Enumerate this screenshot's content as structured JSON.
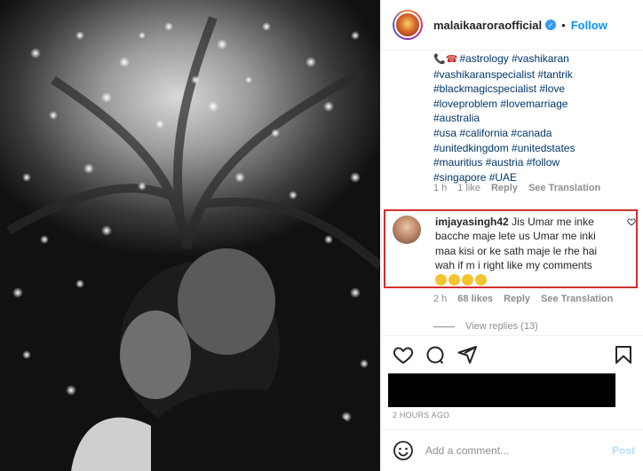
{
  "post": {
    "image": {
      "icon": "selfie-photo"
    }
  },
  "header": {
    "username": "malaikaaroraofficial",
    "verified_icon": "verified-badge-icon",
    "separator": "•",
    "follow_label": "Follow"
  },
  "caption": {
    "lines": [
      "#astrology #vashikaran",
      "#vashikaranspecialist #tantrik",
      "#blackmagicspecialist #love",
      "#loveproblem #lovemarriage",
      "#australia",
      "#usa #california #canada",
      "#unitedkingdom #unitedstates",
      "#mauritius #austria #follow",
      "#singapore #UAE"
    ],
    "meta": {
      "time": "1 h",
      "likes": "1 like",
      "reply": "Reply",
      "translate": "See Translation"
    }
  },
  "comment": {
    "username": "imjayasingh42",
    "lines": [
      "Jis Umar me inke",
      "bacche maje lete us Umar me inki",
      "maa kisi or ke sath maje le rhe hai",
      "wah if m i right like my comments"
    ],
    "emoji_count": 4,
    "meta": {
      "time": "2 h",
      "likes": "68 likes",
      "reply": "Reply",
      "translate": "See Translation"
    }
  },
  "view_replies": "View replies (13)",
  "timestamp": "2 HOURS AGO",
  "add_comment": {
    "placeholder": "Add a comment...",
    "post_label": "Post"
  },
  "colors": {
    "link": "#00376b",
    "follow": "#0095f6",
    "highlight": "#d32f2f",
    "muted": "#8e8e8e"
  }
}
